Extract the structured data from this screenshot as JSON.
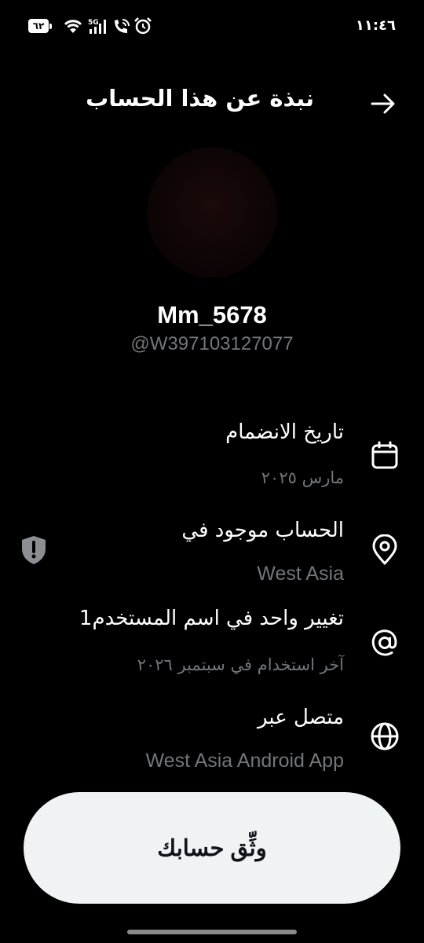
{
  "status_bar": {
    "battery": "٦٢",
    "network": "5G",
    "time": "١١:٤٦"
  },
  "header": {
    "title": "نبذة عن هذا الحساب",
    "back_icon": "arrow-right-icon"
  },
  "profile": {
    "display_name": "Mm_5678",
    "handle": "@W397103127077"
  },
  "info": {
    "joined": {
      "title": "تاريخ الانضمام",
      "value": "مارس ٢٠٢٥",
      "icon": "calendar-icon"
    },
    "location": {
      "title": "الحساب موجود في",
      "value": "West Asia",
      "icon": "location-pin-icon",
      "badge_icon": "shield-alert-icon"
    },
    "username_changes": {
      "title": "تغيير واحد في اسم المستخدم1",
      "value": "آخر استخدام في سبتمبر ٢٠٢٦",
      "icon": "at-sign-icon"
    },
    "connected_via": {
      "title": "متصل عبر",
      "value": "West Asia Android App",
      "icon": "globe-icon"
    }
  },
  "verify_button": {
    "label": "وثِّق حسابك"
  },
  "colors": {
    "background": "#000000",
    "primary_text": "#e7e9ea",
    "secondary_text": "#71767b",
    "button_bg": "#eff3f4"
  }
}
